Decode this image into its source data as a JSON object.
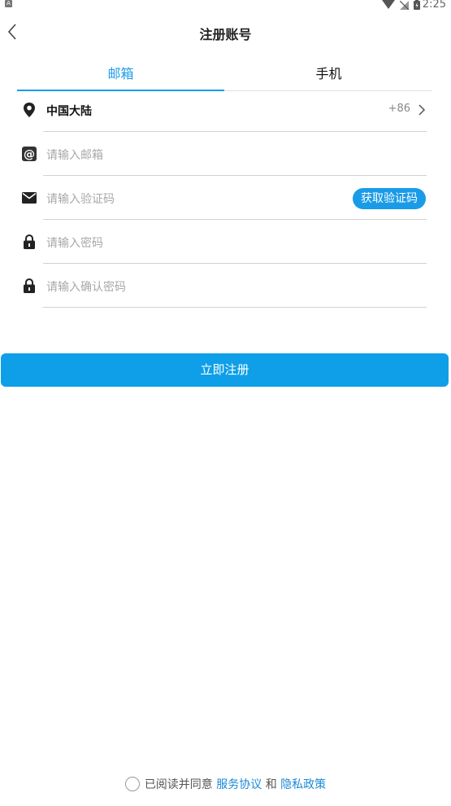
{
  "status_bar": {
    "time": "2:25",
    "notif_letter": "A"
  },
  "header": {
    "title": "注册账号"
  },
  "tabs": [
    {
      "label": "邮箱"
    },
    {
      "label": "手机"
    }
  ],
  "form": {
    "region": {
      "name": "中国大陆",
      "code": "+86"
    },
    "email": {
      "placeholder": "请输入邮箱"
    },
    "code": {
      "placeholder": "请输入验证码",
      "button_label": "获取验证码"
    },
    "password": {
      "placeholder": "请输入密码"
    },
    "confirm_password": {
      "placeholder": "请输入确认密码"
    }
  },
  "submit_label": "立即注册",
  "agreement": {
    "prefix": "已阅读并同意",
    "terms_link": "服务协议",
    "conjunction": "和",
    "privacy_link": "隐私政策"
  },
  "colors": {
    "accent": "#1a9be8",
    "button": "#0e9fe8"
  },
  "icons": [
    "back-arrow-icon",
    "location-pin-icon",
    "at-sign-icon",
    "mail-icon",
    "lock-icon",
    "chevron-right-icon",
    "wifi-icon",
    "no-signal-icon",
    "battery-icon"
  ]
}
